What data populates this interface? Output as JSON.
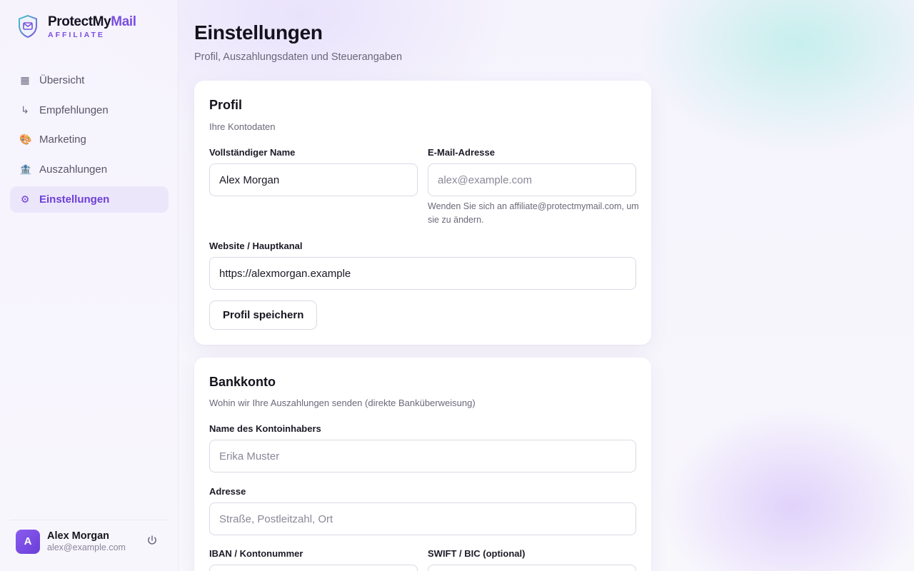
{
  "brand": {
    "name_part1": "ProtectMy",
    "name_part2": "Mail",
    "subtitle": "AFFILIATE",
    "icon": "shield-mail-icon",
    "accent_color": "#7a4fe0"
  },
  "nav": {
    "items": [
      {
        "label": "Übersicht",
        "icon": "grid-icon",
        "glyph": "▦",
        "active": false
      },
      {
        "label": "Empfehlungen",
        "icon": "referral-arrow-icon",
        "glyph": "↳",
        "active": false
      },
      {
        "label": "Marketing",
        "icon": "palette-icon",
        "glyph": "🎨",
        "active": false
      },
      {
        "label": "Auszahlungen",
        "icon": "bank-icon",
        "glyph": "🏦",
        "active": false
      },
      {
        "label": "Einstellungen",
        "icon": "gear-icon",
        "glyph": "⚙",
        "active": true
      }
    ]
  },
  "user": {
    "initial": "A",
    "name": "Alex Morgan",
    "email": "alex@example.com",
    "logout_icon": "power-icon"
  },
  "page": {
    "title": "Einstellungen",
    "subtitle": "Profil, Auszahlungsdaten und Steuerangaben"
  },
  "profile": {
    "title": "Profil",
    "subtitle": "Ihre Kontodaten",
    "name_label": "Vollständiger Name",
    "name_value": "Alex Morgan",
    "email_label": "E-Mail-Adresse",
    "email_placeholder": "alex@example.com",
    "email_hint": "Wenden Sie sich an affiliate@protectmymail.com, um sie zu ändern.",
    "website_label": "Website / Hauptkanal",
    "website_value": "https://alexmorgan.example",
    "save_label": "Profil speichern"
  },
  "bank": {
    "title": "Bankkonto",
    "subtitle": "Wohin wir Ihre Auszahlungen senden (direkte Banküberweisung)",
    "holder_label": "Name des Kontoinhabers",
    "holder_placeholder": "Erika Muster",
    "address_label": "Adresse",
    "address_placeholder": "Straße, Postleitzahl, Ort",
    "iban_label": "IBAN / Kontonummer",
    "iban_value": "",
    "swift_label": "SWIFT / BIC (optional)",
    "swift_value": ""
  }
}
